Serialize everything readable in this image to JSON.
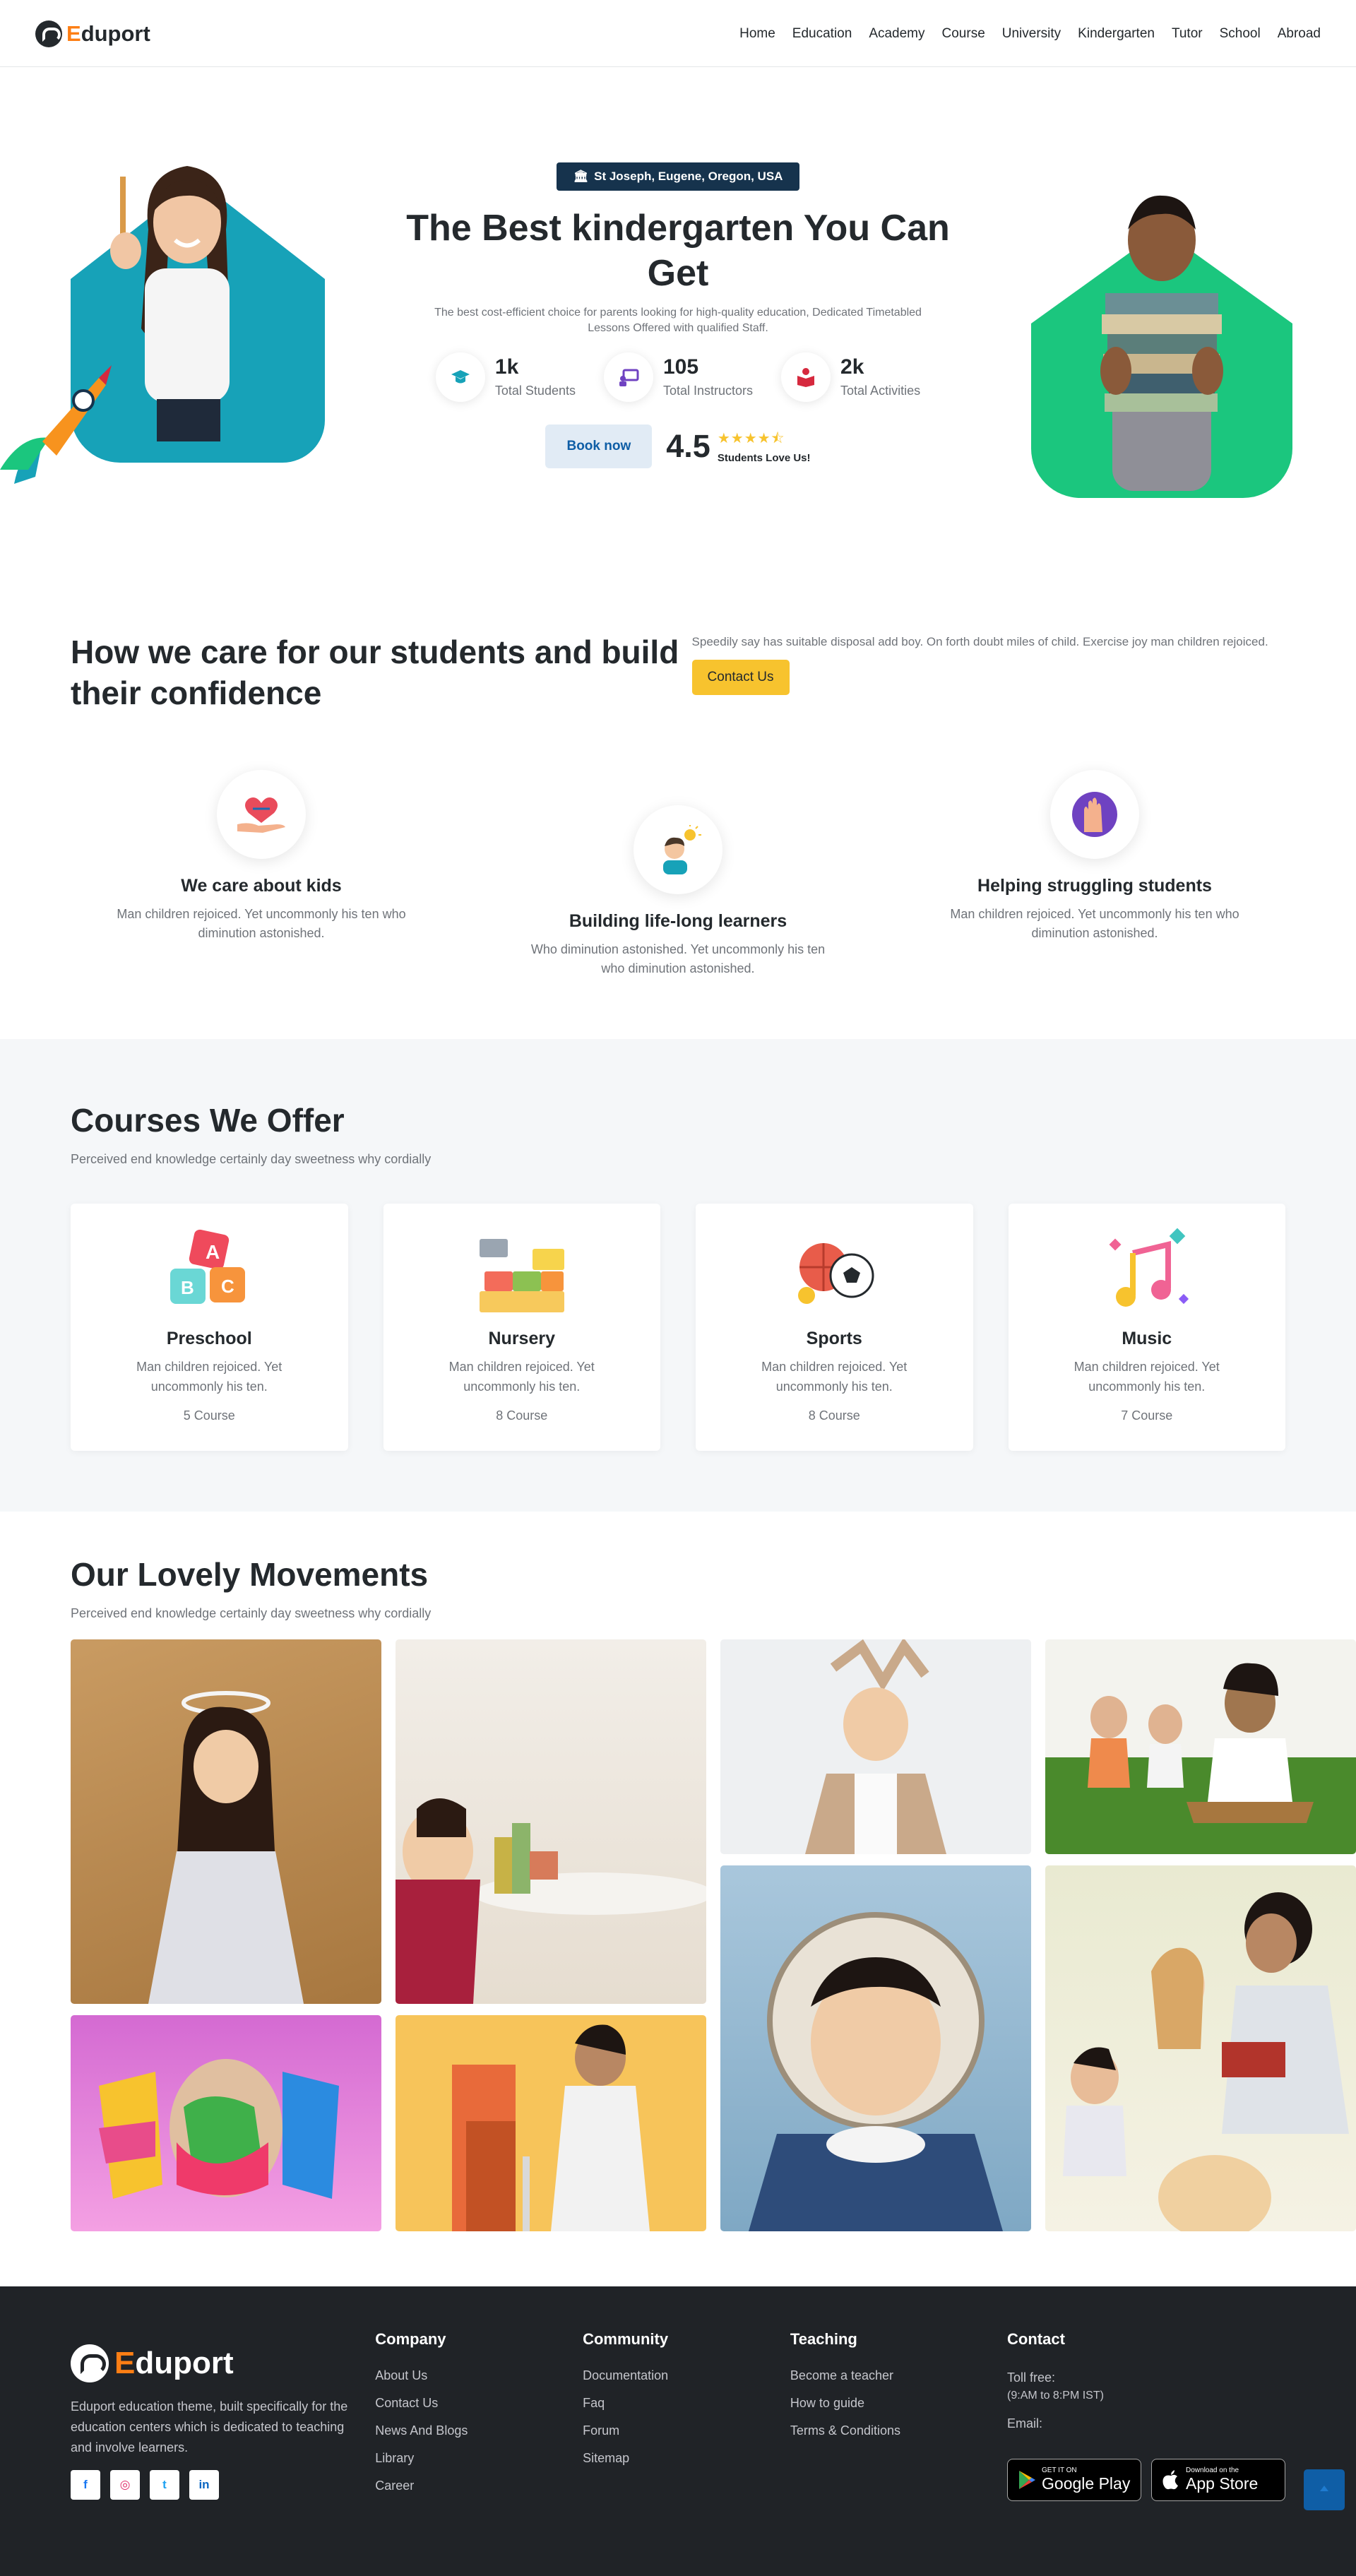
{
  "brand": {
    "letter": "E",
    "rest": "duport"
  },
  "nav": [
    "Home",
    "Education",
    "Academy",
    "Course",
    "University",
    "Kindergarten",
    "Tutor",
    "School",
    "Abroad"
  ],
  "hero": {
    "badge": "St Joseph, Eugene, Oregon, USA",
    "title": "The Best kindergarten You Can Get",
    "description": "The best cost-efficient choice for parents looking for high-quality education, Dedicated Timetabled Lessons Offered with qualified Staff.",
    "stats": [
      {
        "value": "1k",
        "label": "Total Students",
        "icon": "graduation-cap-icon",
        "color": "#17a2b8"
      },
      {
        "value": "105",
        "label": "Total Instructors",
        "icon": "teacher-board-icon",
        "color": "#6f42c1"
      },
      {
        "value": "2k",
        "label": "Total Activities",
        "icon": "book-icon",
        "color": "#d6293e"
      }
    ],
    "book_label": "Book now",
    "rating": "4.5",
    "stars": "★★★★⯪",
    "rating_label": "Students Love Us!"
  },
  "care": {
    "title": "How we care for our students and build their confidence",
    "text": "Speedily say has suitable disposal add boy. On forth doubt miles of child. Exercise joy man children rejoiced.",
    "button": "Contact Us",
    "features": [
      {
        "title": "We care about kids",
        "text": "Man children rejoiced. Yet uncommonly his ten who diminution astonished.",
        "icon": "heart-hand-icon"
      },
      {
        "title": "Building life-long learners",
        "text": "Who diminution astonished. Yet uncommonly his ten who diminution astonished.",
        "icon": "idea-boy-icon"
      },
      {
        "title": "Helping struggling students",
        "text": "Man children rejoiced. Yet uncommonly his ten who diminution astonished.",
        "icon": "raised-hands-icon"
      }
    ]
  },
  "courses": {
    "title": "Courses We Offer",
    "subtitle": "Perceived end knowledge certainly day sweetness why cordially",
    "items": [
      {
        "name": "Preschool",
        "text": "Man children rejoiced. Yet uncommonly his ten.",
        "count": "5 Course",
        "icon": "abc-blocks-icon"
      },
      {
        "name": "Nursery",
        "text": "Man children rejoiced. Yet uncommonly his ten.",
        "count": "8 Course",
        "icon": "lego-bricks-icon"
      },
      {
        "name": "Sports",
        "text": "Man children rejoiced. Yet uncommonly his ten.",
        "count": "8 Course",
        "icon": "balls-icon"
      },
      {
        "name": "Music",
        "text": "Man children rejoiced. Yet uncommonly his ten.",
        "count": "7 Course",
        "icon": "music-notes-icon"
      }
    ]
  },
  "movements": {
    "title": "Our Lovely Movements",
    "subtitle": "Perceived end knowledge certainly day sweetness why cordially"
  },
  "footer": {
    "description": "Eduport education theme, built specifically for the education centers which is dedicated to teaching and involve learners.",
    "socials": [
      "f",
      "◎",
      "t",
      "in"
    ],
    "company": {
      "title": "Company",
      "links": [
        "About Us",
        "Contact Us",
        "News And Blogs",
        "Library",
        "Career"
      ]
    },
    "community": {
      "title": "Community",
      "links": [
        "Documentation",
        "Faq",
        "Forum",
        "Sitemap"
      ]
    },
    "teaching": {
      "title": "Teaching",
      "links": [
        "Become a teacher",
        "How to guide",
        "Terms & Conditions"
      ]
    },
    "contact": {
      "title": "Contact",
      "tollfree": "Toll free:",
      "hours": "(9:AM to 8:PM IST)",
      "email": "Email:"
    },
    "google": {
      "small": "GET IT ON",
      "big": "Google Play"
    },
    "apple": {
      "small": "Download on the",
      "big": "App Store"
    }
  }
}
